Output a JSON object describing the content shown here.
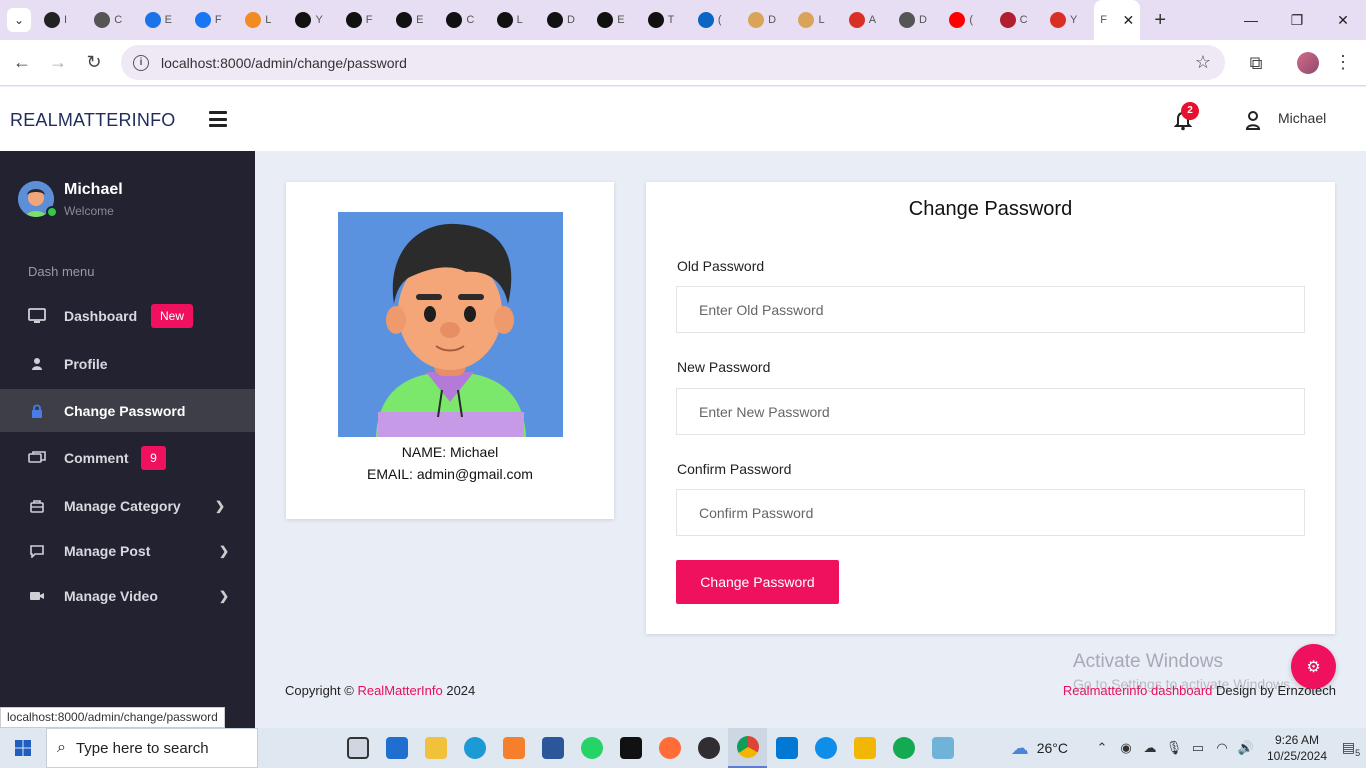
{
  "browser": {
    "tabs": [
      {
        "label": "I",
        "color": "#222222"
      },
      {
        "label": "C",
        "color": "#555555"
      },
      {
        "label": "E",
        "color": "#1a73e8"
      },
      {
        "label": "F",
        "color": "#1877f2"
      },
      {
        "label": "L",
        "color": "#f28b22"
      },
      {
        "label": "Y",
        "color": "#111111"
      },
      {
        "label": "F",
        "color": "#111111"
      },
      {
        "label": "E",
        "color": "#111111"
      },
      {
        "label": "C",
        "color": "#111111"
      },
      {
        "label": "L",
        "color": "#111111"
      },
      {
        "label": "D",
        "color": "#111111"
      },
      {
        "label": "E",
        "color": "#111111"
      },
      {
        "label": "T",
        "color": "#111111"
      },
      {
        "label": "(",
        "color": "#0a66c2"
      },
      {
        "label": "D",
        "color": "#d9a45a"
      },
      {
        "label": "L",
        "color": "#d9a45a"
      },
      {
        "label": "A",
        "color": "#d93025"
      },
      {
        "label": "D",
        "color": "#555555"
      },
      {
        "label": "(",
        "color": "#ff0000"
      },
      {
        "label": "C",
        "color": "#b01e2f"
      },
      {
        "label": "Y",
        "color": "#d93025"
      }
    ],
    "active_tab_label": "F",
    "url": "localhost:8000/admin/change/password",
    "status_url": "localhost:8000/admin/change/password"
  },
  "header": {
    "brand": "REALMATTERINFO",
    "notification_count": "2",
    "user_name": "Michael"
  },
  "sidebar": {
    "user_name": "Michael",
    "welcome": "Welcome",
    "section_label": "Dash menu",
    "items": [
      {
        "label": "Dashboard",
        "icon": "monitor-icon",
        "badge": "New"
      },
      {
        "label": "Profile",
        "icon": "user-icon"
      },
      {
        "label": "Change Password",
        "icon": "lock-icon",
        "active": true
      },
      {
        "label": "Comment",
        "icon": "comment-icon",
        "badge": "9"
      },
      {
        "label": "Manage Category",
        "icon": "briefcase-icon"
      },
      {
        "label": "Manage Post",
        "icon": "message-icon"
      },
      {
        "label": "Manage Video",
        "icon": "video-icon"
      }
    ]
  },
  "profile_card": {
    "name_line": "NAME: Michael",
    "email_line": "EMAIL: admin@gmail.com"
  },
  "form": {
    "title": "Change Password",
    "old_label": "Old Password",
    "old_placeholder": "Enter Old Password",
    "new_label": "New Password",
    "new_placeholder": "Enter New Password",
    "confirm_label": "Confirm Password",
    "confirm_placeholder": "Confirm Password",
    "submit_label": "Change Password"
  },
  "footer": {
    "copyright_prefix": "Copyright ©",
    "site_link": "RealMatterInfo",
    "year": "2024",
    "dashboard_link": "Realmatterinfo dashboard",
    "design_by": "Design by Ernzotech"
  },
  "watermark": {
    "line1": "Activate Windows",
    "line2": "Go to Settings to activate Windows."
  },
  "taskbar": {
    "search_placeholder": "Type here to search",
    "temperature": "26°C",
    "weather_badge": "1",
    "time": "9:26 AM",
    "date": "10/25/2024",
    "notification_count": "5"
  },
  "colors": {
    "accent": "#f0115e",
    "sidebar_bg": "#222230",
    "page_bg": "#e9edf6",
    "brand": "#1f2d5c"
  }
}
